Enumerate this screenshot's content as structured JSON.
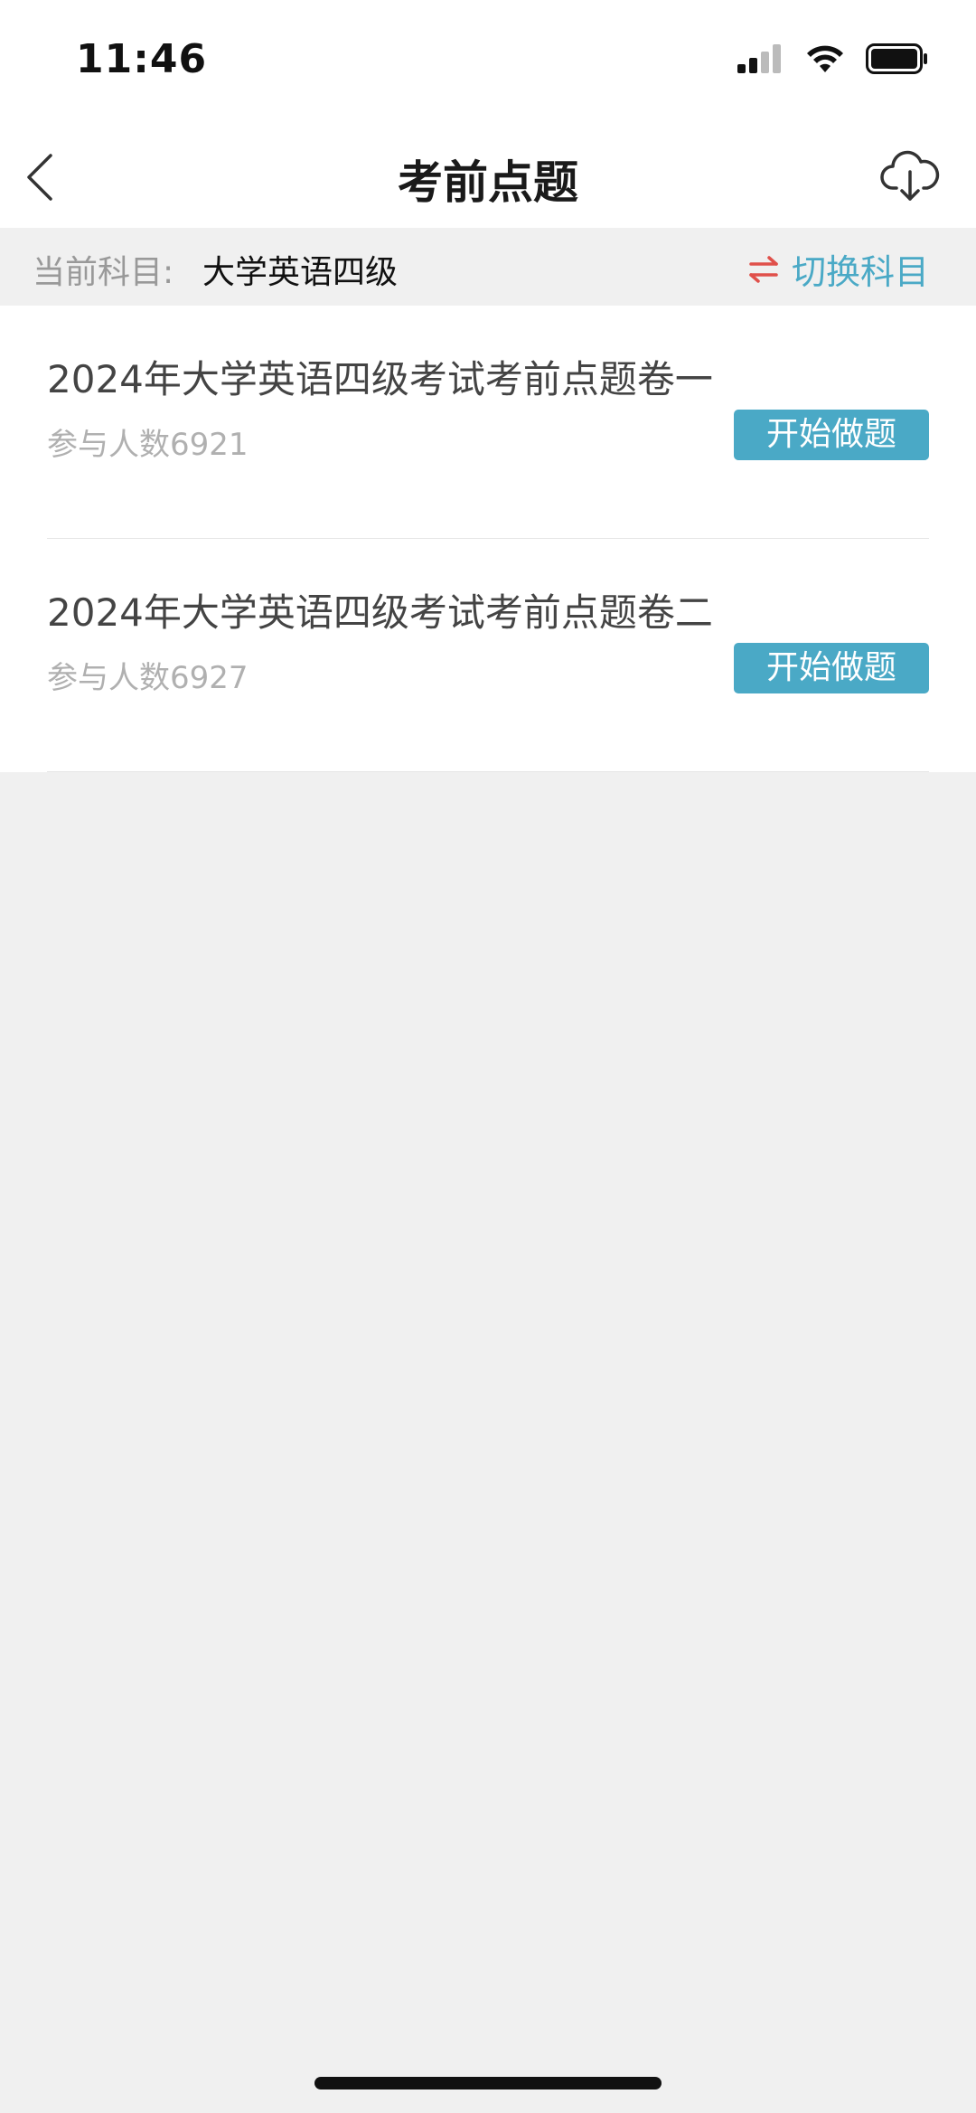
{
  "status_bar": {
    "time": "11:46",
    "icons": [
      "signal-icon",
      "wifi-icon",
      "battery-icon"
    ]
  },
  "nav": {
    "title": "考前点题",
    "back_icon": "chevron-left-icon",
    "download_icon": "cloud-download-icon"
  },
  "subject": {
    "label": "当前科目:",
    "value": "大学英语四级",
    "switch_label": "切换科目",
    "switch_icon": "swap-arrows-icon"
  },
  "papers": [
    {
      "title": "2024年大学英语四级考试考前点题卷一",
      "participants": "参与人数6921",
      "button": "开始做题"
    },
    {
      "title": "2024年大学英语四级考试考前点题卷二",
      "participants": "参与人数6927",
      "button": "开始做题"
    }
  ],
  "colors": {
    "accent": "#4aa9c6",
    "switch_icon": "#e0504a",
    "background": "#f0f0f0"
  }
}
